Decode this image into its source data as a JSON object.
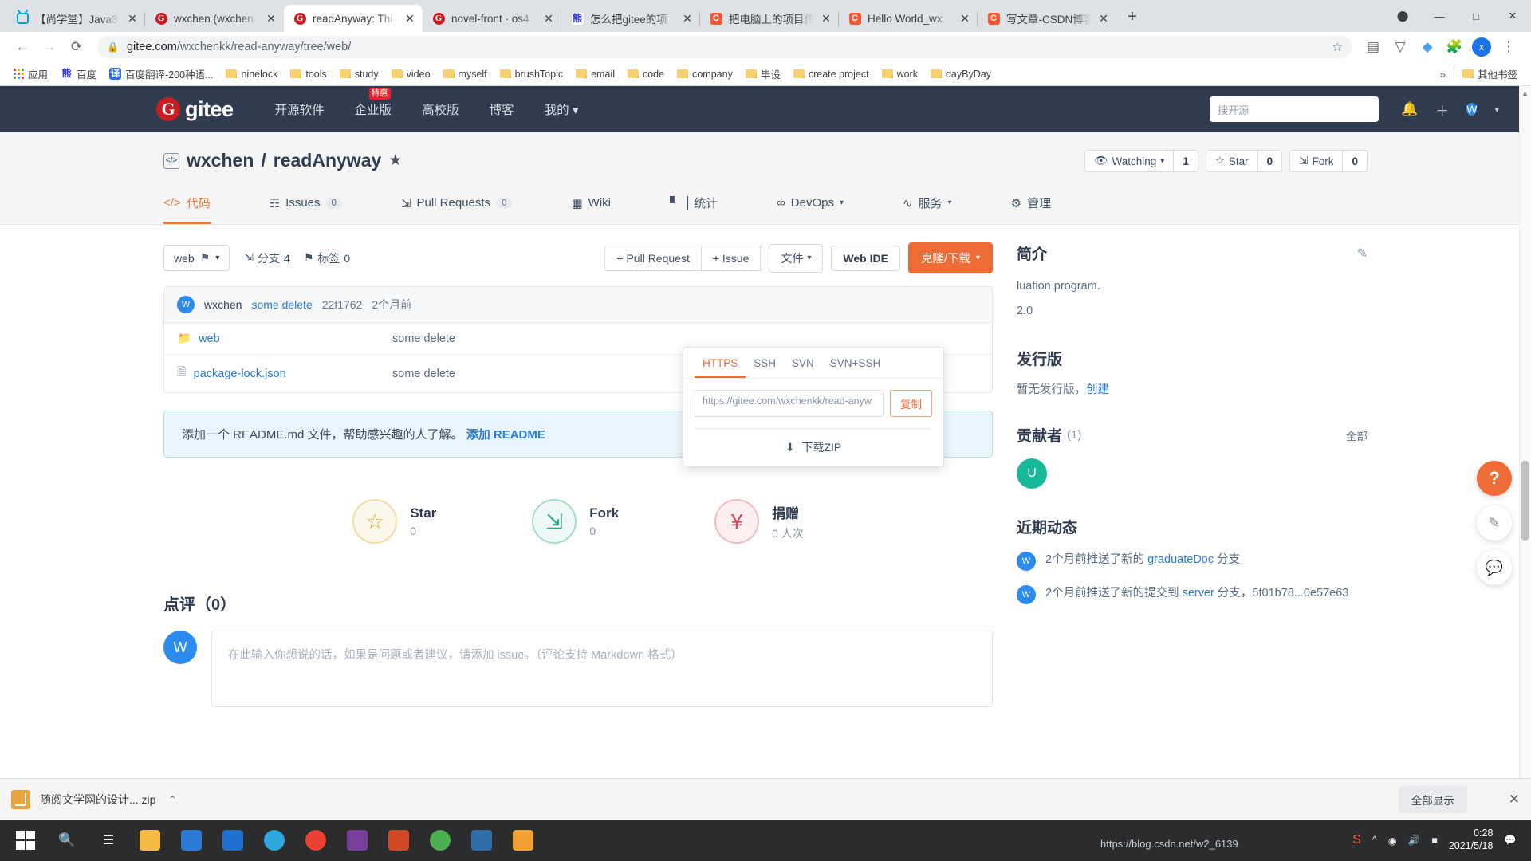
{
  "browser": {
    "tabs": [
      {
        "title": "【尚学堂】Java3",
        "favicon": "bilibili-icon",
        "active": false
      },
      {
        "title": "wxchen (wxchen",
        "favicon": "gitee-icon",
        "active": false
      },
      {
        "title": "readAnyway: Thi",
        "favicon": "gitee-icon",
        "active": true
      },
      {
        "title": "novel-front · os4",
        "favicon": "gitee-icon",
        "active": false
      },
      {
        "title": "怎么把gitee的项",
        "favicon": "baidu-icon",
        "active": false
      },
      {
        "title": "把电脑上的项目传",
        "favicon": "csdn-icon",
        "active": false
      },
      {
        "title": "Hello World_wx",
        "favicon": "csdn-icon",
        "active": false
      },
      {
        "title": "写文章-CSDN博客",
        "favicon": "csdn-icon",
        "active": false
      }
    ],
    "new_tab_label": "+",
    "window_controls": {
      "minimize": "—",
      "maximize": "□",
      "close": "✕"
    },
    "nav": {
      "back": "←",
      "forward": "→",
      "reload": "⟳"
    },
    "omnibox": {
      "lock": "lock-icon",
      "host": "gitee.com",
      "path": "/wxchenkk/read-anyway/tree/web/",
      "star": "☆"
    },
    "profile_initial": "x",
    "bookmarks": [
      {
        "label": "应用",
        "icon": "apps-grid-icon"
      },
      {
        "label": "百度",
        "icon": "baidu-icon"
      },
      {
        "label": "百度翻译-200种语...",
        "icon": "translate-icon"
      },
      {
        "label": "ninelock",
        "icon": "folder-icon"
      },
      {
        "label": "tools",
        "icon": "folder-icon"
      },
      {
        "label": "study",
        "icon": "folder-icon"
      },
      {
        "label": "video",
        "icon": "folder-icon"
      },
      {
        "label": "myself",
        "icon": "folder-icon"
      },
      {
        "label": "brushTopic",
        "icon": "folder-icon"
      },
      {
        "label": "email",
        "icon": "folder-icon"
      },
      {
        "label": "code",
        "icon": "folder-icon"
      },
      {
        "label": "company",
        "icon": "folder-icon"
      },
      {
        "label": "毕设",
        "icon": "folder-icon"
      },
      {
        "label": "create project",
        "icon": "folder-icon"
      },
      {
        "label": "work",
        "icon": "folder-icon"
      },
      {
        "label": "dayByDay",
        "icon": "folder-icon"
      }
    ],
    "bookmarks_overflow": "»",
    "other_bookmarks": "其他书签"
  },
  "gitee": {
    "logo_text": "gitee",
    "logo_mark": "G",
    "nav_items": [
      {
        "label": "开源软件",
        "badge": null,
        "caret": false
      },
      {
        "label": "企业版",
        "badge": "特惠",
        "caret": false
      },
      {
        "label": "高校版",
        "badge": null,
        "caret": false
      },
      {
        "label": "博客",
        "badge": null,
        "caret": false
      },
      {
        "label": "我的",
        "badge": null,
        "caret": true
      }
    ],
    "search_placeholder": "搜开源",
    "bell_icon": "bell-icon",
    "plus_icon": "plus-icon",
    "user_initial": "W",
    "user_caret": "▾"
  },
  "repo": {
    "owner": "wxchen",
    "separator": "/",
    "name": "readAnyway",
    "medal_icon": "medal-icon",
    "actions": [
      {
        "name": "watching",
        "icon": "eye-icon",
        "label": "Watching",
        "caret": "▾",
        "count": "1"
      },
      {
        "name": "star",
        "icon": "star-icon",
        "label": "Star",
        "caret": "",
        "count": "0"
      },
      {
        "name": "fork",
        "icon": "fork-icon",
        "label": "Fork",
        "caret": "",
        "count": "0"
      }
    ],
    "tabs": [
      {
        "label": "代码",
        "icon": "code-icon",
        "count": null,
        "active": true,
        "caret": false
      },
      {
        "label": "Issues",
        "icon": "issue-icon",
        "count": "0",
        "active": false,
        "caret": false
      },
      {
        "label": "Pull Requests",
        "icon": "pullrequest-icon",
        "count": "0",
        "active": false,
        "caret": false
      },
      {
        "label": "Wiki",
        "icon": "wiki-icon",
        "count": null,
        "active": false,
        "caret": false
      },
      {
        "label": "统计",
        "icon": "chart-icon",
        "count": null,
        "active": false,
        "caret": false
      },
      {
        "label": "DevOps",
        "icon": "infinity-icon",
        "count": null,
        "active": false,
        "caret": true
      },
      {
        "label": "服务",
        "icon": "pulse-icon",
        "count": null,
        "active": false,
        "caret": true
      },
      {
        "label": "管理",
        "icon": "settings-icon",
        "count": null,
        "active": false,
        "caret": false
      }
    ]
  },
  "toolbar": {
    "branch_name": "web",
    "branch_icon": "branch-tag-icon",
    "branch_caret": "▾",
    "branches_label": "分支",
    "branches_count": "4",
    "tags_label": "标签",
    "tags_count": "0",
    "pull_request_btn": "+ Pull Request",
    "issue_btn": "+ Issue",
    "files_btn": "文件",
    "files_caret": "▾",
    "web_ide_btn": "Web IDE",
    "clone_btn": "克隆/下载",
    "clone_caret": "▾"
  },
  "clone_popover": {
    "tabs": [
      "HTTPS",
      "SSH",
      "SVN",
      "SVN+SSH"
    ],
    "active_tab": "HTTPS",
    "url": "https://gitee.com/wxchenkk/read-anyw",
    "copy_label": "复制",
    "download_zip": "下载ZIP",
    "download_icon": "download-icon"
  },
  "commit": {
    "avatar_initial": "W",
    "author": "wxchen",
    "message": "some delete",
    "sha": "22f1762",
    "time": "2个月前"
  },
  "files": [
    {
      "name": "web",
      "icon": "folder-icon",
      "message": "some delete",
      "time": ""
    },
    {
      "name": "package-lock.json",
      "icon": "file-icon",
      "message": "some delete",
      "time": ""
    }
  ],
  "readme_tip": {
    "text": "添加一个 README.md 文件，帮助感兴趣的人了解。",
    "action": "添加 README"
  },
  "social": [
    {
      "name": "star",
      "icon": "star-icon",
      "label": "Star",
      "value": "0"
    },
    {
      "name": "fork",
      "icon": "fork-icon",
      "label": "Fork",
      "value": "0"
    },
    {
      "name": "donate",
      "icon": "donate-icon",
      "label": "捐赠",
      "value": "0 人次"
    }
  ],
  "comments": {
    "heading": "点评（0）",
    "avatar_initial": "W",
    "placeholder": "在此输入你想说的话，如果是问题或者建议，请添加 issue。（评论支持 Markdown 格式）"
  },
  "sidebar": {
    "intro_title": "简介",
    "edit_icon": "edit-icon",
    "intro_text": "luation program.",
    "intro_extra": "2.0",
    "releases_title": "发行版",
    "releases_text": "暂无发行版，",
    "releases_link": "创建",
    "contributors_title": "贡献者",
    "contributors_count": "(1)",
    "contributors_all": "全部",
    "contributor_initial": "U",
    "activity_title": "近期动态",
    "activities": [
      {
        "avatar": "W",
        "text": "2个月前推送了新的 ",
        "link": "graduateDoc",
        "suffix": " 分支"
      },
      {
        "avatar": "W",
        "text": "2个月前推送了新的提交到 ",
        "link": "server",
        "suffix": " 分支，5f01b78...0e57e63"
      }
    ]
  },
  "float_widgets": [
    {
      "name": "help",
      "glyph": "?"
    },
    {
      "name": "feedback",
      "glyph": "✎"
    },
    {
      "name": "chat",
      "glyph": "💬"
    }
  ],
  "download_bar": {
    "file_name": "随阅文学网的设计....zip",
    "caret": "⌃",
    "show_all": "全部显示",
    "close": "✕"
  },
  "taskbar": {
    "clock_time": "0:28",
    "clock_date": "2021/5/18",
    "watermark": "https://blog.csdn.net/w2_6139"
  }
}
